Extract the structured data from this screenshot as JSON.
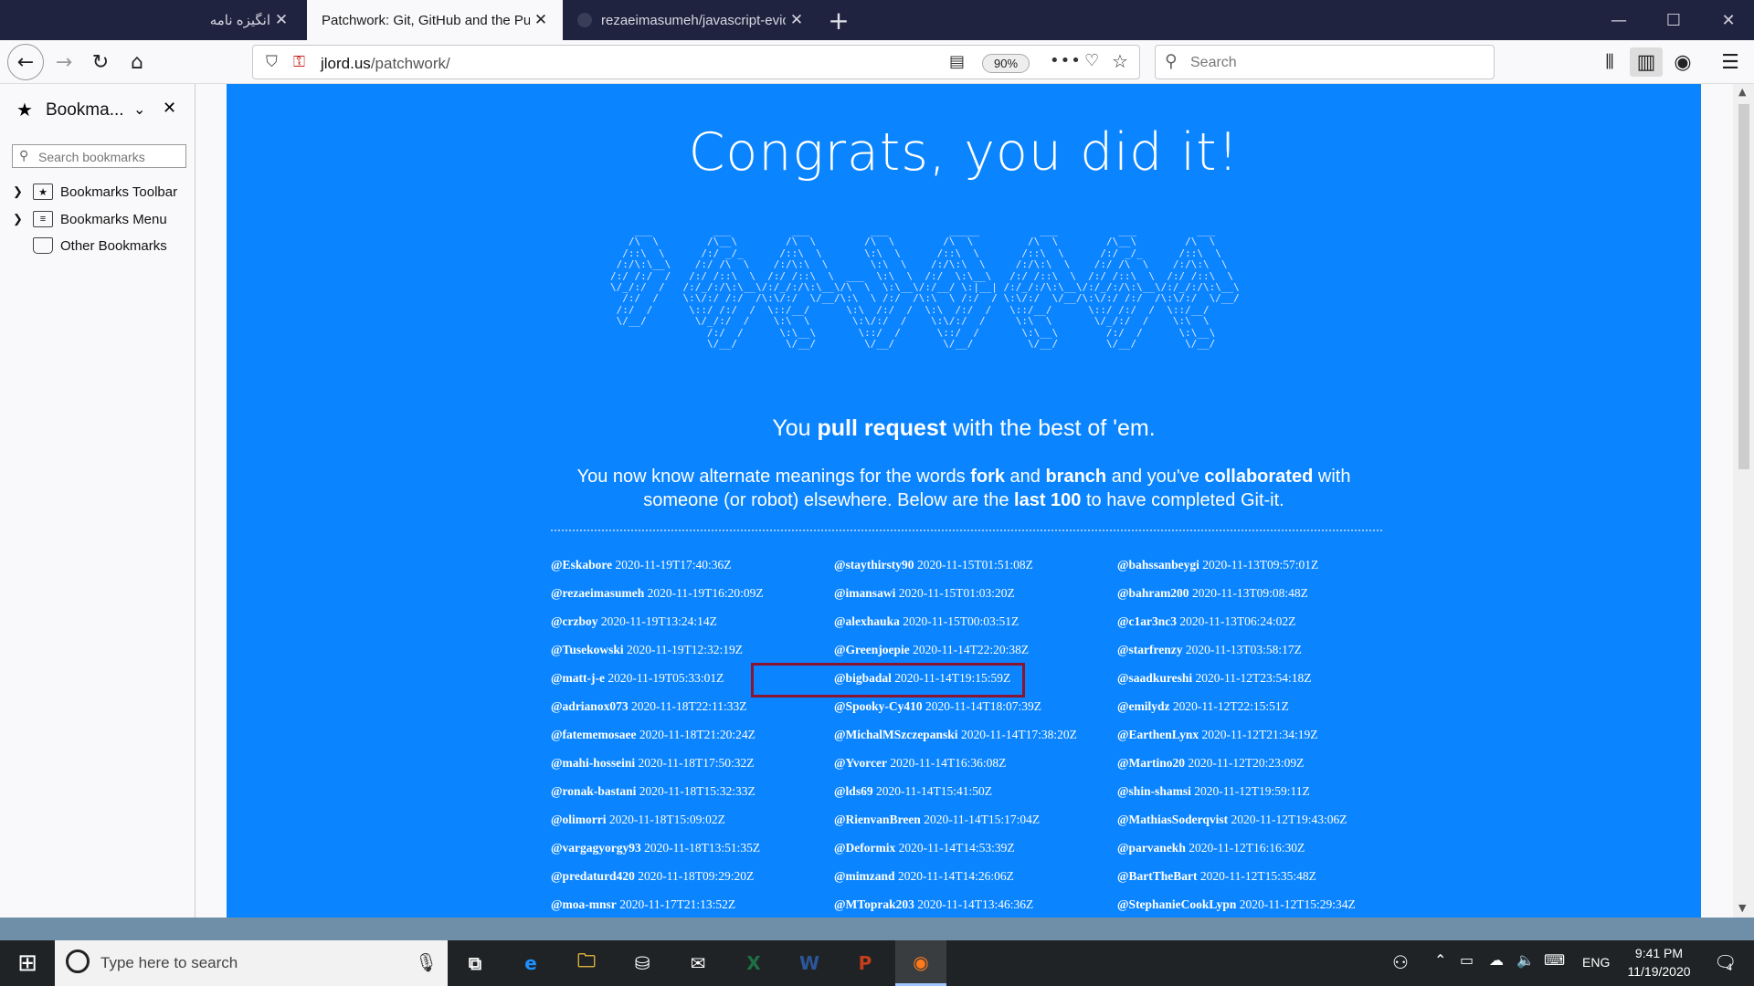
{
  "browser": {
    "tabs": [
      {
        "title": "انگیزه نامه",
        "active": false
      },
      {
        "title": "Patchwork: Git, GitHub and the Purs",
        "active": true
      },
      {
        "title": "rezaeimasumeh/javascript-evic",
        "active": false
      }
    ],
    "url_host": "jlord.us",
    "url_path": "/patchwork/",
    "zoom": "90%",
    "search_placeholder": "Search"
  },
  "sidebar": {
    "title": "Bookma...",
    "search_placeholder": "Search bookmarks",
    "items": [
      {
        "label": "Bookmarks Toolbar",
        "expandable": true
      },
      {
        "label": "Bookmarks Menu",
        "expandable": true
      },
      {
        "label": "Other Bookmarks",
        "expandable": false
      }
    ]
  },
  "page": {
    "headline": "Congrats, you did it!",
    "sub1_pre": "You ",
    "sub1_bold": "pull request",
    "sub1_post": " with the best of 'em.",
    "sub2": {
      "p1": "You now know alternate meanings for the words ",
      "b1": "fork",
      "p2": " and ",
      "b2": "branch",
      "p3": " and you've ",
      "b3": "collaborated",
      "p4": " with someone (or robot) elsewhere. Below are the ",
      "b4": "last 100",
      "p5": " to have completed Git-it."
    },
    "columns": [
      [
        {
          "user": "@Eskabore",
          "time": "2020-11-19T17:40:36Z"
        },
        {
          "user": "@rezaeimasumeh",
          "time": "2020-11-19T16:20:09Z"
        },
        {
          "user": "@crzboy",
          "time": "2020-11-19T13:24:14Z"
        },
        {
          "user": "@Tusekowski",
          "time": "2020-11-19T12:32:19Z"
        },
        {
          "user": "@matt-j-e",
          "time": "2020-11-19T05:33:01Z"
        },
        {
          "user": "@adrianox073",
          "time": "2020-11-18T22:11:33Z"
        },
        {
          "user": "@fatememosaee",
          "time": "2020-11-18T21:20:24Z"
        },
        {
          "user": "@mahi-hosseini",
          "time": "2020-11-18T17:50:32Z"
        },
        {
          "user": "@ronak-bastani",
          "time": "2020-11-18T15:32:33Z"
        },
        {
          "user": "@olimorri",
          "time": "2020-11-18T15:09:02Z"
        },
        {
          "user": "@vargagyorgy93",
          "time": "2020-11-18T13:51:35Z"
        },
        {
          "user": "@predaturd420",
          "time": "2020-11-18T09:29:20Z"
        },
        {
          "user": "@moa-mnsr",
          "time": "2020-11-17T21:13:52Z"
        }
      ],
      [
        {
          "user": "@staythirsty90",
          "time": "2020-11-15T01:51:08Z"
        },
        {
          "user": "@imansawi",
          "time": "2020-11-15T01:03:20Z"
        },
        {
          "user": "@alexhauka",
          "time": "2020-11-15T00:03:51Z"
        },
        {
          "user": "@Greenjoepie",
          "time": "2020-11-14T22:20:38Z"
        },
        {
          "user": "@bigbadal",
          "time": "2020-11-14T19:15:59Z"
        },
        {
          "user": "@Spooky-Cy410",
          "time": "2020-11-14T18:07:39Z"
        },
        {
          "user": "@MichalMSzczepanski",
          "time": "2020-11-14T17:38:20Z"
        },
        {
          "user": "@Yvorcer",
          "time": "2020-11-14T16:36:08Z"
        },
        {
          "user": "@lds69",
          "time": "2020-11-14T15:41:50Z"
        },
        {
          "user": "@RienvanBreen",
          "time": "2020-11-14T15:17:04Z"
        },
        {
          "user": "@Deformix",
          "time": "2020-11-14T14:53:39Z"
        },
        {
          "user": "@mimzand",
          "time": "2020-11-14T14:26:06Z"
        },
        {
          "user": "@MToprak203",
          "time": "2020-11-14T13:46:36Z"
        }
      ],
      [
        {
          "user": "@bahssanbeygi",
          "time": "2020-11-13T09:57:01Z"
        },
        {
          "user": "@bahram200",
          "time": "2020-11-13T09:08:48Z"
        },
        {
          "user": "@c1ar3nc3",
          "time": "2020-11-13T06:24:02Z"
        },
        {
          "user": "@starfrenzy",
          "time": "2020-11-13T03:58:17Z"
        },
        {
          "user": "@saadkureshi",
          "time": "2020-11-12T23:54:18Z"
        },
        {
          "user": "@emilydz",
          "time": "2020-11-12T22:15:51Z"
        },
        {
          "user": "@EarthenLynx",
          "time": "2020-11-12T21:34:19Z"
        },
        {
          "user": "@Martino20",
          "time": "2020-11-12T20:23:09Z"
        },
        {
          "user": "@shin-shamsi",
          "time": "2020-11-12T19:59:11Z"
        },
        {
          "user": "@MathiasSoderqvist",
          "time": "2020-11-12T19:43:06Z"
        },
        {
          "user": "@parvanekh",
          "time": "2020-11-12T16:16:30Z"
        },
        {
          "user": "@BartTheBart",
          "time": "2020-11-12T15:35:48Z"
        },
        {
          "user": "@StephanieCookLypn",
          "time": "2020-11-12T15:29:34Z"
        }
      ]
    ]
  },
  "taskbar": {
    "search_placeholder": "Type here to search",
    "lang": "ENG",
    "time": "9:41 PM",
    "date": "11/19/2020",
    "notifications": "4",
    "apps": [
      "task-view-icon",
      "edge-icon",
      "file-explorer-icon",
      "store-icon",
      "mail-icon",
      "excel-icon",
      "word-icon",
      "powerpoint-icon",
      "firefox-icon"
    ]
  },
  "colors": {
    "page_bg": "#0a84ff",
    "highlight_box": "#8a1530",
    "tab_bar": "#202340"
  }
}
